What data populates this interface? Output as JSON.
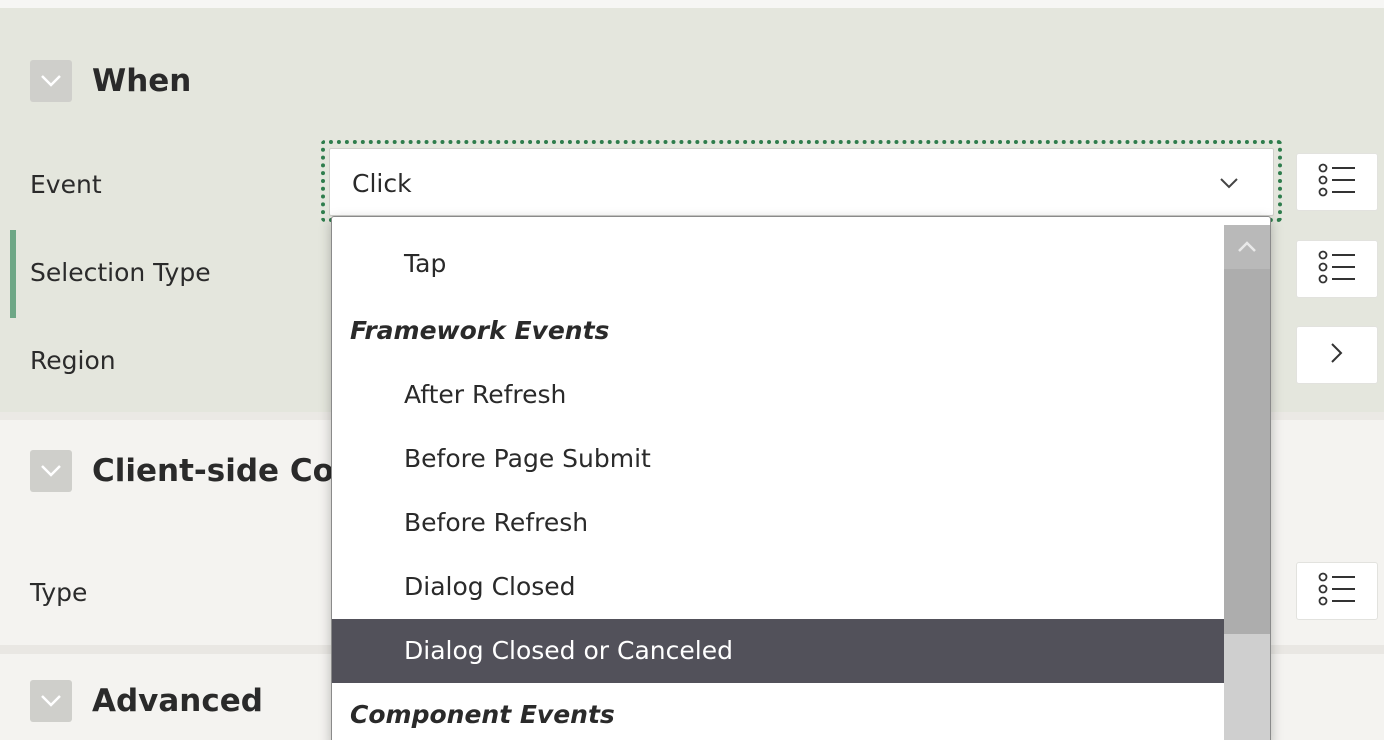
{
  "sections": {
    "when": {
      "title": "When"
    },
    "client_side": {
      "title": "Client-side Co"
    },
    "advanced": {
      "title": "Advanced"
    }
  },
  "fields": {
    "event": {
      "label": "Event",
      "value": "Click"
    },
    "selection_type": {
      "label": "Selection Type"
    },
    "region": {
      "label": "Region"
    },
    "type": {
      "label": "Type"
    }
  },
  "dropdown": {
    "items": [
      {
        "kind": "option",
        "label": "Tap"
      },
      {
        "kind": "group",
        "label": "Framework Events"
      },
      {
        "kind": "option",
        "label": "After Refresh"
      },
      {
        "kind": "option",
        "label": "Before Page Submit"
      },
      {
        "kind": "option",
        "label": "Before Refresh"
      },
      {
        "kind": "option",
        "label": "Dialog Closed"
      },
      {
        "kind": "option",
        "label": "Dialog Closed or Canceled",
        "selected": true
      },
      {
        "kind": "group",
        "label": "Component Events"
      }
    ]
  },
  "icons": {
    "collapse": "chevron-down-icon",
    "list_picker": "list-picker-icon",
    "navigate": "chevron-right-icon"
  },
  "colors": {
    "focus_outline": "#2f7d4d",
    "selected_bg": "#52515a",
    "when_section_bg": "#e4e6dd"
  }
}
